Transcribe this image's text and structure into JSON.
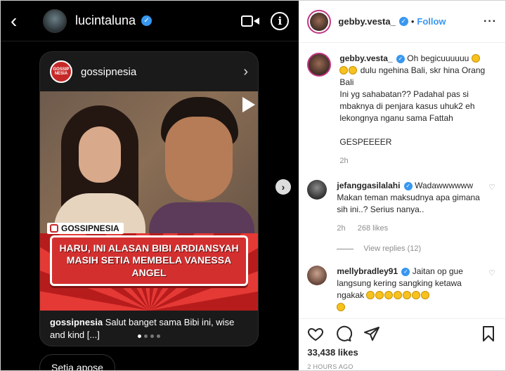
{
  "dm": {
    "back_glyph": "‹",
    "username": "lucintaluna",
    "verified_glyph": "✓",
    "info_glyph": "i",
    "shared_post": {
      "account": "gossipnesia",
      "logo_text": "GOSSIP NESIA",
      "chevron": "›",
      "overlay_tag": "GOSSIPNESIA",
      "headline": "HARU, INI ALASAN BIBI ARDIANSYAH MASIH SETIA MEMBELA VANESSA ANGEL",
      "caption_user": "gossipnesia",
      "caption_text": " Salut banget sama Bibi ini, wise and kind [...]"
    },
    "carousel_next_glyph": "›",
    "message_preview": "Setia apose"
  },
  "post": {
    "username": "gebby.vesta_",
    "verified_glyph": "✓",
    "separator": "•",
    "follow_label": "Follow",
    "more_glyph": "···",
    "caption": {
      "username": "gebby.vesta_",
      "line1": " Oh begicuuuuuu",
      "line2": " dulu ngehina Bali, skr hina Orang Bali",
      "line3": "Ini yg sahabatan?? Padahal pas si mbaknya di penjara kasus uhuk2 eh lekongnya nganu sama Fattah",
      "line4": "GESPEEEER",
      "time": "2h"
    },
    "comments": [
      {
        "username": "jefanggasilalahi",
        "text": " Wadawwwwww Makan teman maksudnya apa gimana sih ini..? Serius nanya..",
        "time": "2h",
        "likes": "268 likes",
        "view_replies": "View replies (12)"
      },
      {
        "username": "mellybradley91",
        "text": " Jaitan op gue langsung kering sangking ketawa ngakak"
      }
    ],
    "likes_count": "33,438 likes",
    "timestamp": "2 HOURS AGO"
  },
  "colors": {
    "verified_blue": "#3897f0",
    "banner_red": "#d32f2f",
    "dark_bg": "#000000"
  }
}
